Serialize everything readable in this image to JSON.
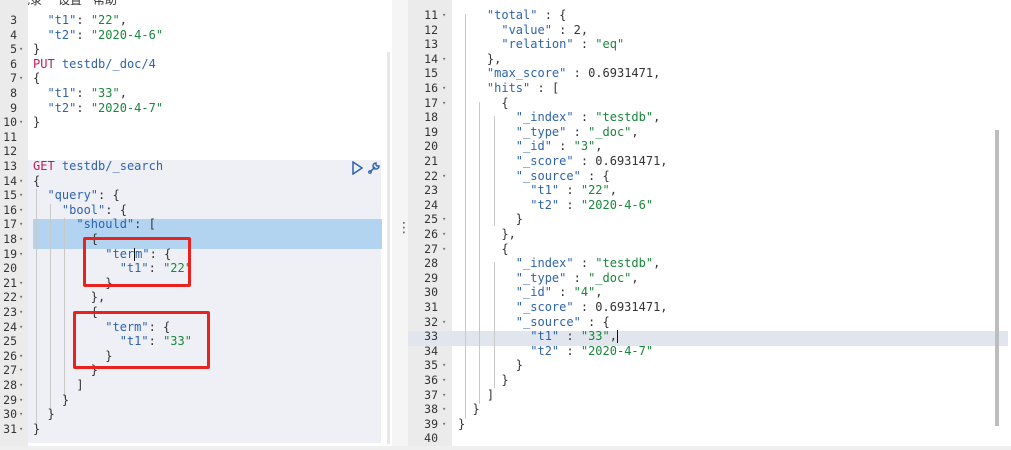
{
  "menubar": {
    "item1": "历史记录",
    "item2": "设置",
    "item3": "帮助"
  },
  "request_editor": {
    "lines": [
      {
        "n": "3",
        "fold": false,
        "html": "  <span class='n'>\"t1\"</span>: <span class='s'>\"22\"</span>,"
      },
      {
        "n": "4",
        "fold": false,
        "html": "  <span class='n'>\"t2\"</span>: <span class='s'>\"2020-4-6\"</span>"
      },
      {
        "n": "5",
        "fold": true,
        "html": "}"
      },
      {
        "n": "6",
        "fold": false,
        "html": "<span class='m'>PUT</span> <span class='n'>testdb/_doc/4</span>"
      },
      {
        "n": "7",
        "fold": true,
        "html": "{"
      },
      {
        "n": "8",
        "fold": false,
        "html": "  <span class='n'>\"t1\"</span>: <span class='s'>\"33\"</span>,"
      },
      {
        "n": "9",
        "fold": false,
        "html": "  <span class='n'>\"t2\"</span>: <span class='s'>\"2020-4-7\"</span>"
      },
      {
        "n": "10",
        "fold": true,
        "html": "}"
      },
      {
        "n": "11",
        "fold": false,
        "html": ""
      },
      {
        "n": "12",
        "fold": false,
        "html": ""
      },
      {
        "n": "13",
        "fold": false,
        "html": "<span class='m'>GET</span> <span class='n'>testdb/_search</span>"
      },
      {
        "n": "14",
        "fold": true,
        "html": "{"
      },
      {
        "n": "15",
        "fold": true,
        "html": "  <span class='n'>\"query\"</span>: {"
      },
      {
        "n": "16",
        "fold": true,
        "html": "    <span class='n'>\"bool\"</span>: {"
      },
      {
        "n": "17",
        "fold": true,
        "html": "      <span class='n'>\"should\"</span>: ["
      },
      {
        "n": "18",
        "fold": true,
        "html": "        {"
      },
      {
        "n": "19",
        "fold": true,
        "html": "          <span class='n'>\"ter</span><span class='cursor'></span><span class='n'>m\"</span>: {"
      },
      {
        "n": "20",
        "fold": false,
        "html": "            <span class='n'>\"t1\"</span>: <span class='s'>\"22\"</span>"
      },
      {
        "n": "21",
        "fold": true,
        "html": "          }"
      },
      {
        "n": "22",
        "fold": true,
        "html": "        },"
      },
      {
        "n": "23",
        "fold": true,
        "html": "        {"
      },
      {
        "n": "24",
        "fold": true,
        "html": "          <span class='n'>\"term\"</span>: {"
      },
      {
        "n": "25",
        "fold": false,
        "html": "            <span class='n'>\"t1\"</span>: <span class='s'>\"33\"</span>"
      },
      {
        "n": "26",
        "fold": true,
        "html": "          }"
      },
      {
        "n": "27",
        "fold": true,
        "html": "        }"
      },
      {
        "n": "28",
        "fold": true,
        "html": "      ]"
      },
      {
        "n": "29",
        "fold": true,
        "html": "    }"
      },
      {
        "n": "30",
        "fold": true,
        "html": "  }"
      },
      {
        "n": "31",
        "fold": true,
        "html": "}"
      }
    ]
  },
  "response_viewer": {
    "lines": [
      {
        "n": "11",
        "fold": true,
        "html": "    <span class='n'>\"total\"</span> : {"
      },
      {
        "n": "12",
        "fold": false,
        "html": "      <span class='n'>\"value\"</span> : 2,"
      },
      {
        "n": "13",
        "fold": false,
        "html": "      <span class='n'>\"relation\"</span> : <span class='s'>\"eq\"</span>"
      },
      {
        "n": "14",
        "fold": true,
        "html": "    },"
      },
      {
        "n": "15",
        "fold": false,
        "html": "    <span class='n'>\"max_score\"</span> : 0.6931471,"
      },
      {
        "n": "16",
        "fold": true,
        "html": "    <span class='n'>\"hits\"</span> : ["
      },
      {
        "n": "17",
        "fold": true,
        "html": "      {"
      },
      {
        "n": "18",
        "fold": false,
        "html": "        <span class='n'>\"_index\"</span> : <span class='s'>\"testdb\"</span>,"
      },
      {
        "n": "19",
        "fold": false,
        "html": "        <span class='n'>\"_type\"</span> : <span class='s'>\"_doc\"</span>,"
      },
      {
        "n": "20",
        "fold": false,
        "html": "        <span class='n'>\"_id\"</span> : <span class='s'>\"3\"</span>,"
      },
      {
        "n": "21",
        "fold": false,
        "html": "        <span class='n'>\"_score\"</span> : 0.6931471,"
      },
      {
        "n": "22",
        "fold": true,
        "html": "        <span class='n'>\"_source\"</span> : {"
      },
      {
        "n": "23",
        "fold": false,
        "html": "          <span class='n'>\"t1\"</span> : <span class='s'>\"22\"</span>,"
      },
      {
        "n": "24",
        "fold": false,
        "html": "          <span class='n'>\"t2\"</span> : <span class='s'>\"2020-4-6\"</span>"
      },
      {
        "n": "25",
        "fold": true,
        "html": "        }"
      },
      {
        "n": "26",
        "fold": true,
        "html": "      },"
      },
      {
        "n": "27",
        "fold": true,
        "html": "      {"
      },
      {
        "n": "28",
        "fold": false,
        "html": "        <span class='n'>\"_index\"</span> : <span class='s'>\"testdb\"</span>,"
      },
      {
        "n": "29",
        "fold": false,
        "html": "        <span class='n'>\"_type\"</span> : <span class='s'>\"_doc\"</span>,"
      },
      {
        "n": "30",
        "fold": false,
        "html": "        <span class='n'>\"_id\"</span> : <span class='s'>\"4\"</span>,"
      },
      {
        "n": "31",
        "fold": false,
        "html": "        <span class='n'>\"_score\"</span> : 0.6931471,"
      },
      {
        "n": "32",
        "fold": true,
        "html": "        <span class='n'>\"_source\"</span> : {"
      },
      {
        "n": "33",
        "fold": false,
        "html": "          <span class='n'>\"t1\"</span> : <span class='s'>\"33\"</span>,<span class='cursor'></span>"
      },
      {
        "n": "34",
        "fold": false,
        "html": "          <span class='n'>\"t2\"</span> : <span class='s'>\"2020-4-7\"</span>"
      },
      {
        "n": "35",
        "fold": true,
        "html": "        }"
      },
      {
        "n": "36",
        "fold": true,
        "html": "      }"
      },
      {
        "n": "37",
        "fold": true,
        "html": "    ]"
      },
      {
        "n": "38",
        "fold": true,
        "html": "  }"
      },
      {
        "n": "39",
        "fold": true,
        "html": "}"
      },
      {
        "n": "40",
        "fold": false,
        "html": ""
      }
    ]
  },
  "colors": {
    "annotation": "#e8231f",
    "selection": "#b3d4f0",
    "line_highlight": "#e1e6ee"
  },
  "icons": {
    "run": "play-triangle-icon",
    "settings": "wrench-icon",
    "splitter": "vertical-dots-icon"
  }
}
